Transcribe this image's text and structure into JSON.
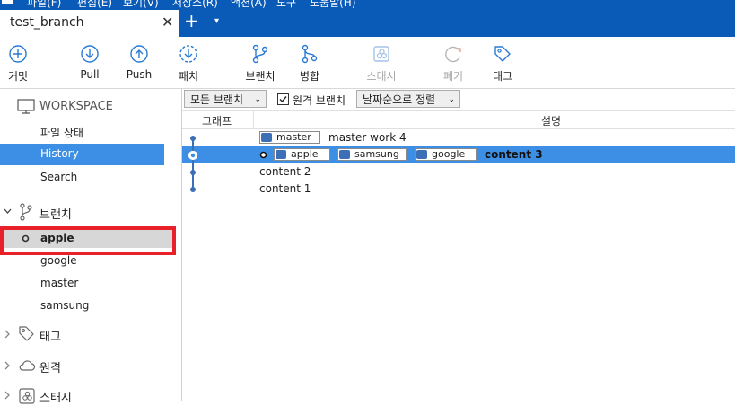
{
  "window": {
    "menu": [
      "파일(F)",
      "편집(E)",
      "보기(V)",
      "저장소(R)",
      "액션(A)",
      "도구",
      "도움말(H)"
    ],
    "tab_title": "test_branch",
    "tab_close": "✕",
    "tab_add": "+",
    "tab_dropdown": "▾"
  },
  "toolbar": {
    "commit": "커밋",
    "pull": "Pull",
    "push": "Push",
    "fetch": "패치",
    "branch": "브랜치",
    "merge": "병합",
    "stash": "스태시",
    "discard": "폐기",
    "tag": "태그"
  },
  "sidebar": {
    "workspace": "WORKSPACE",
    "file_status": "파일 상태",
    "history": "History",
    "search": "Search",
    "branches": "브랜치",
    "branch_items": [
      "apple",
      "google",
      "master",
      "samsung"
    ],
    "tags": "태그",
    "remotes": "원격",
    "stashes": "스태시"
  },
  "filter": {
    "all_branches": "모든 브랜치",
    "remote_branches": "원격 브랜치",
    "sort": "날짜순으로 정렬"
  },
  "columns": {
    "graph": "그래프",
    "description": "설명"
  },
  "commits": [
    {
      "branches": [
        "master"
      ],
      "message": "master work 4",
      "selected": false
    },
    {
      "branches": [
        "apple",
        "samsung",
        "google"
      ],
      "message": "content 3",
      "selected": true,
      "head": true
    },
    {
      "branches": [],
      "message": "content 2",
      "selected": false
    },
    {
      "branches": [],
      "message": "content 1",
      "selected": false
    }
  ],
  "colors": {
    "titlebar": "#0a5ab8",
    "selection": "#3d8fe6",
    "graph_line": "#3d6fb6",
    "highlight_box": "#e8202a"
  }
}
